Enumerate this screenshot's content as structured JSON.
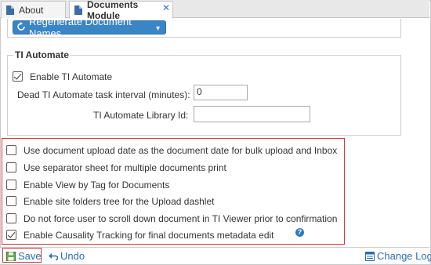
{
  "tabs": [
    {
      "label": "About"
    },
    {
      "label": "Documents Module"
    }
  ],
  "actions": {
    "regenerate_label": "Regenerate Document Names"
  },
  "ti_automate": {
    "legend": "TI Automate",
    "enable_label": "Enable TI Automate",
    "enable_checked": true,
    "dead_interval_label": "Dead TI Automate task interval (minutes):",
    "dead_interval_value": "0",
    "library_id_label": "TI Automate Library Id:",
    "library_id_value": ""
  },
  "options": [
    {
      "label": "Use document upload date as the document date for bulk upload and Inbox",
      "checked": false
    },
    {
      "label": "Use separator sheet for multiple documents print",
      "checked": false
    },
    {
      "label": "Enable View by Tag for Documents",
      "checked": false
    },
    {
      "label": "Enable site folders tree for the Upload dashlet",
      "checked": false
    },
    {
      "label": "Do not force user to scroll down document in TI Viewer prior to confirmation",
      "checked": false
    },
    {
      "label": "Enable Causality Tracking for final documents metadata edit",
      "checked": true
    }
  ],
  "footer": {
    "save_label": "Save",
    "undo_label": "Undo",
    "change_log_label": "Change Log"
  },
  "colors": {
    "accent": "#3a85c6",
    "link": "#2a6fb0",
    "highlight": "#d0393a"
  }
}
